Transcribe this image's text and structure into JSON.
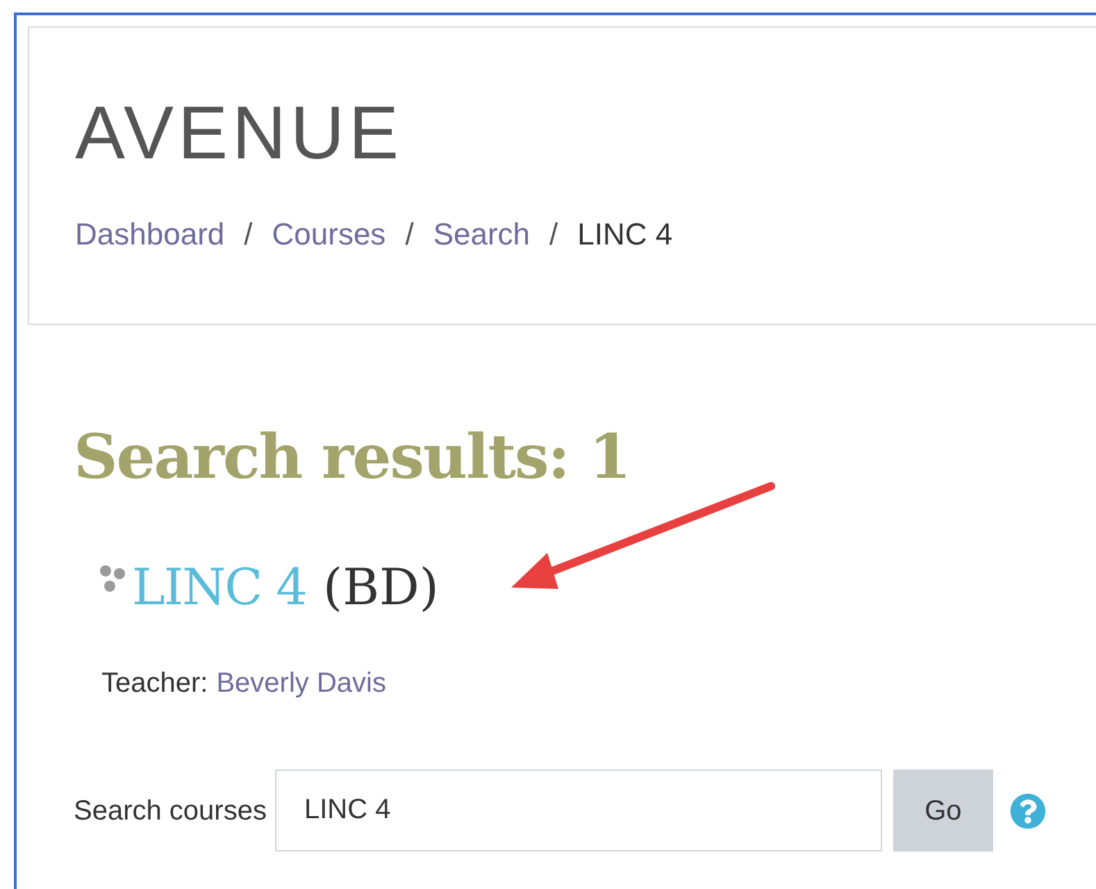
{
  "site_title": "AVENUE",
  "breadcrumb": [
    {
      "label": "Dashboard",
      "link": true
    },
    {
      "label": "Courses",
      "link": true
    },
    {
      "label": "Search",
      "link": true
    },
    {
      "label": "LINC 4",
      "link": false
    }
  ],
  "breadcrumb_separator": "/",
  "heading": "Search results: 1",
  "results": [
    {
      "name": "LINC 4",
      "suffix": "(BD)",
      "teacher_label": "Teacher:",
      "teacher": "Beverly Davis"
    }
  ],
  "search": {
    "label": "Search courses",
    "value": "LINC 4",
    "button": "Go"
  }
}
